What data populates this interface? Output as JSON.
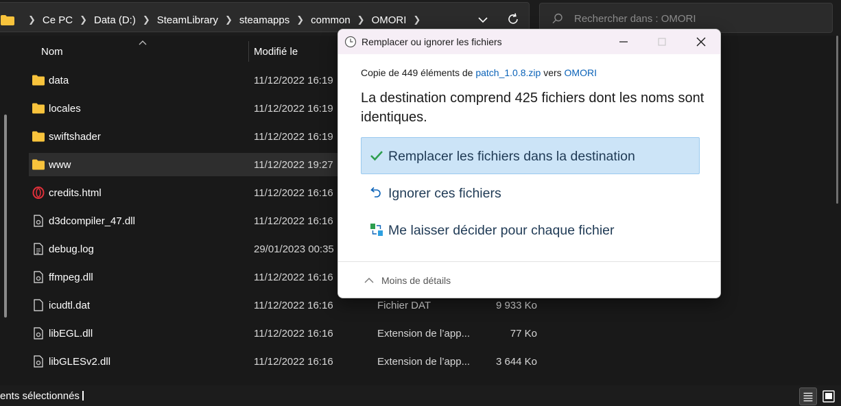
{
  "address_bar": {
    "crumbs": [
      "Ce PC",
      "Data (D:)",
      "SteamLibrary",
      "steamapps",
      "common",
      "OMORI"
    ]
  },
  "search": {
    "placeholder": "Rechercher dans : OMORI"
  },
  "columns": {
    "name": "Nom",
    "modified": "Modifié le"
  },
  "files": [
    {
      "name": "data",
      "icon": "folder-icon",
      "modified": "11/12/2022 16:19",
      "type": "",
      "size": ""
    },
    {
      "name": "locales",
      "icon": "folder-icon",
      "modified": "11/12/2022 16:19",
      "type": "",
      "size": ""
    },
    {
      "name": "swiftshader",
      "icon": "folder-icon",
      "modified": "11/12/2022 16:19",
      "type": "",
      "size": ""
    },
    {
      "name": "www",
      "icon": "folder-icon",
      "modified": "11/12/2022 19:27",
      "type": "",
      "size": "",
      "selected": true
    },
    {
      "name": "credits.html",
      "icon": "opera-html-icon",
      "modified": "11/12/2022 16:16",
      "type": "",
      "size": ""
    },
    {
      "name": "d3dcompiler_47.dll",
      "icon": "dll-file-icon",
      "modified": "11/12/2022 16:16",
      "type": "",
      "size": ""
    },
    {
      "name": "debug.log",
      "icon": "text-file-icon",
      "modified": "29/01/2023 00:35",
      "type": "",
      "size": ""
    },
    {
      "name": "ffmpeg.dll",
      "icon": "dll-file-icon",
      "modified": "11/12/2022 16:16",
      "type": "",
      "size": ""
    },
    {
      "name": "icudtl.dat",
      "icon": "blank-file-icon",
      "modified": "11/12/2022 16:16",
      "type": "Fichier DAT",
      "size": "9 933 Ko"
    },
    {
      "name": "libEGL.dll",
      "icon": "dll-file-icon",
      "modified": "11/12/2022 16:16",
      "type": "Extension de l’app...",
      "size": "77 Ko"
    },
    {
      "name": "libGLESv2.dll",
      "icon": "dll-file-icon",
      "modified": "11/12/2022 16:16",
      "type": "Extension de l’app...",
      "size": "3 644 Ko"
    }
  ],
  "status_bar": {
    "text": "ents sélectionnés"
  },
  "dialog": {
    "title": "Remplacer ou ignorer les fichiers",
    "copy_prefix": "Copie de 449 éléments de ",
    "copy_source": "patch_1.0.8.zip",
    "copy_middle": " vers ",
    "copy_dest": "OMORI",
    "heading": "La destination comprend 425 fichiers dont les noms sont identiques.",
    "options": [
      {
        "label": "Remplacer les fichiers dans la destination",
        "icon": "checkmark-icon"
      },
      {
        "label": "Ignorer ces fichiers",
        "icon": "undo-arrow-icon"
      },
      {
        "label": "Me laisser décider pour chaque fichier",
        "icon": "compare-files-icon"
      }
    ],
    "less_details": "Moins de détails"
  },
  "colors": {
    "accent": "#0a62b8",
    "primary_option_bg": "#cce4f7",
    "folder_yellow": "#f8c33c",
    "check_green": "#2e9e4f"
  }
}
